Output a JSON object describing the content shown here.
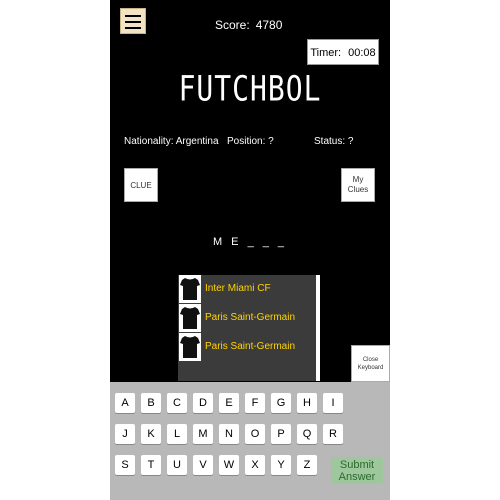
{
  "header": {
    "score_label": "Score:",
    "score_value": "4780",
    "timer_label": "Timer:",
    "timer_value": "00:08"
  },
  "logo": "FUTCHBOL",
  "info": {
    "nationality": "Nationality: Argentina",
    "position": "Position: ?",
    "status": "Status: ?"
  },
  "buttons": {
    "clue": "CLUE",
    "my_clues_1": "My",
    "my_clues_2": "Clues",
    "close_keyboard_1": "Close",
    "close_keyboard_2": "Keyboard",
    "submit_1": "Submit",
    "submit_2": "Answer"
  },
  "answer_pattern": "M E _ _ _",
  "suggestions": [
    {
      "team": "Inter Miami CF",
      "icon": "shirt-icon"
    },
    {
      "team": "Paris Saint-Germain",
      "icon": "shirt-icon"
    },
    {
      "team": "Paris Saint-Germain",
      "icon": "shirt-icon"
    }
  ],
  "keyboard": {
    "row1": [
      "A",
      "B",
      "C",
      "D",
      "E",
      "F",
      "G",
      "H",
      "I"
    ],
    "row2": [
      "J",
      "K",
      "L",
      "M",
      "N",
      "O",
      "P",
      "Q",
      "R"
    ],
    "row3": [
      "S",
      "T",
      "U",
      "V",
      "W",
      "X",
      "Y",
      "Z"
    ]
  },
  "colors": {
    "background": "#000000",
    "suggestion_text": "#ffd400",
    "keyboard_bg": "#b8b8b8",
    "submit_bg": "#9ec79e"
  }
}
